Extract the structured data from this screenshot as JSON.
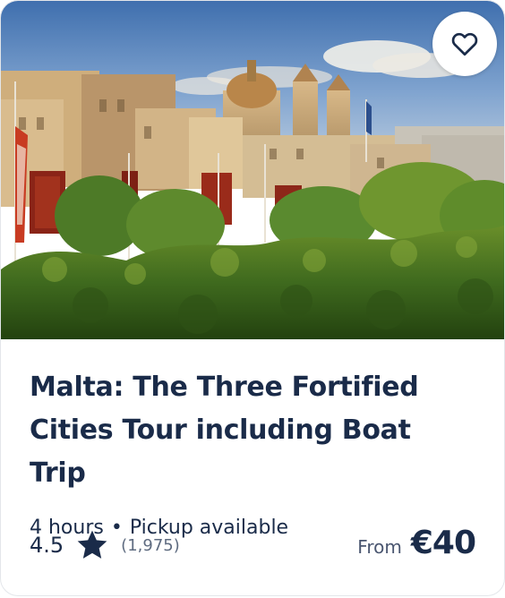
{
  "card": {
    "image_alt": "Malta: The Three Fortified Cities Tour including Boat Trip",
    "title": "Malta: The Three Fortified Cities Tour including Boat Trip",
    "duration": "4 hours",
    "separator": "•",
    "pickup": "Pickup available",
    "rating": "4.5",
    "review_count": "(1,975)",
    "price_prefix": "From",
    "price": "€40"
  },
  "icons": {
    "favorite": "heart-outline-icon",
    "rating": "star-icon"
  },
  "colors": {
    "text_primary": "#1a2b49",
    "text_secondary": "#5e6b80",
    "star": "#1a2b49",
    "card_border": "#e3e6ea"
  }
}
